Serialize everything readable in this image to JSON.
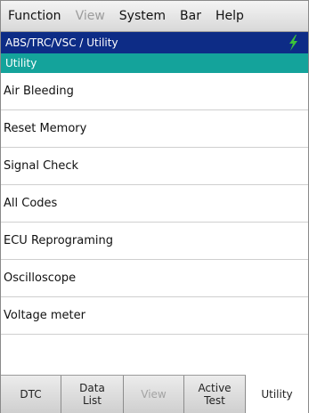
{
  "menu": [
    {
      "label": "Function",
      "enabled": true
    },
    {
      "label": "View",
      "enabled": false
    },
    {
      "label": "System",
      "enabled": true
    },
    {
      "label": "Bar",
      "enabled": true
    },
    {
      "label": "Help",
      "enabled": true
    }
  ],
  "title": "ABS/TRC/VSC / Utility",
  "status_icon": "lightning-bolt-icon",
  "subheader": "Utility",
  "list_items": [
    "Air Bleeding",
    "Reset Memory",
    "Signal Check",
    "All Codes",
    "ECU Reprograming",
    "Oscilloscope",
    "Voltage meter"
  ],
  "tabs": [
    {
      "label": "DTC",
      "enabled": true,
      "active": false
    },
    {
      "label": "Data\nList",
      "enabled": true,
      "active": false
    },
    {
      "label": "View",
      "enabled": false,
      "active": false
    },
    {
      "label": "Active\nTest",
      "enabled": true,
      "active": false
    },
    {
      "label": "Utility",
      "enabled": true,
      "active": true
    }
  ],
  "colors": {
    "title_bg": "#0d2c86",
    "subheader_bg": "#14a39b",
    "bolt": "#3cc23a"
  }
}
